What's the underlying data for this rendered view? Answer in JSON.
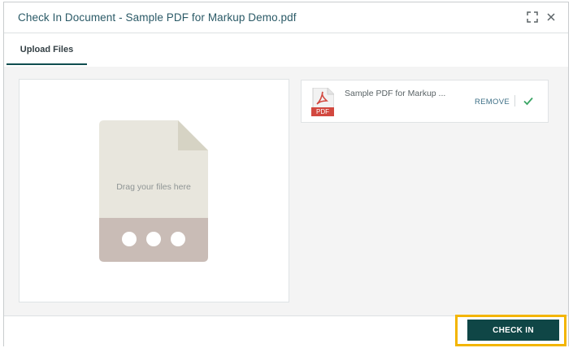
{
  "dialog": {
    "title": "Check In Document - Sample PDF for Markup Demo.pdf",
    "icons": {
      "expand": "expand-icon",
      "close": "close-icon"
    }
  },
  "tabs": [
    {
      "label": "Upload Files",
      "active": true
    }
  ],
  "dropzone": {
    "prompt": "Drag your files here",
    "illustration": "document-upload-icon"
  },
  "file": {
    "icon": "pdf-file-icon",
    "icon_label": "PDF",
    "name": "Sample PDF for Markup ...",
    "remove_label": "REMOVE",
    "status_icon": "checkmark-icon"
  },
  "footer": {
    "checkin_label": "CHECK IN"
  },
  "colors": {
    "accent": "#0f4646",
    "tab_underline": "#0f4d4f",
    "highlight": "#f3b500",
    "success": "#3aa565",
    "pdf_red": "#d2483f"
  }
}
